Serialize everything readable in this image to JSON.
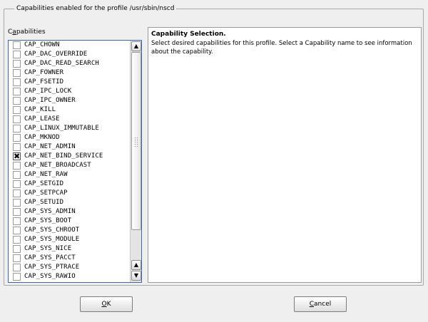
{
  "group_title": "Capabilities enabled for the profile /usr/sbin/nscd",
  "capabilities_label": {
    "pre": "C",
    "mnemonic": "a",
    "post": "pabilities"
  },
  "capabilities": [
    {
      "name": "CAP_CHOWN",
      "checked": false
    },
    {
      "name": "CAP_DAC_OVERRIDE",
      "checked": false
    },
    {
      "name": "CAP_DAC_READ_SEARCH",
      "checked": false
    },
    {
      "name": "CAP_FOWNER",
      "checked": false
    },
    {
      "name": "CAP_FSETID",
      "checked": false
    },
    {
      "name": "CAP_IPC_LOCK",
      "checked": false
    },
    {
      "name": "CAP_IPC_OWNER",
      "checked": false
    },
    {
      "name": "CAP_KILL",
      "checked": false
    },
    {
      "name": "CAP_LEASE",
      "checked": false
    },
    {
      "name": "CAP_LINUX_IMMUTABLE",
      "checked": false
    },
    {
      "name": "CAP_MKNOD",
      "checked": false
    },
    {
      "name": "CAP_NET_ADMIN",
      "checked": false
    },
    {
      "name": "CAP_NET_BIND_SERVICE",
      "checked": true
    },
    {
      "name": "CAP_NET_BROADCAST",
      "checked": false
    },
    {
      "name": "CAP_NET_RAW",
      "checked": false
    },
    {
      "name": "CAP_SETGID",
      "checked": false
    },
    {
      "name": "CAP_SETPCAP",
      "checked": false
    },
    {
      "name": "CAP_SETUID",
      "checked": false
    },
    {
      "name": "CAP_SYS_ADMIN",
      "checked": false
    },
    {
      "name": "CAP_SYS_BOOT",
      "checked": false
    },
    {
      "name": "CAP_SYS_CHROOT",
      "checked": false
    },
    {
      "name": "CAP_SYS_MODULE",
      "checked": false
    },
    {
      "name": "CAP_SYS_NICE",
      "checked": false
    },
    {
      "name": "CAP_SYS_PACCT",
      "checked": false
    },
    {
      "name": "CAP_SYS_PTRACE",
      "checked": false
    },
    {
      "name": "CAP_SYS_RAWIO",
      "checked": false
    }
  ],
  "info": {
    "title": "Capability Selection.",
    "text": "Select desired capabilities for this profile. Select a Capability name to see information about the capability."
  },
  "buttons": {
    "ok": {
      "mnemonic": "O",
      "rest": "K"
    },
    "cancel": {
      "mnemonic": "C",
      "rest": "ancel"
    }
  },
  "icons": {
    "scroll_up": "up-arrow",
    "scroll_down": "down-arrow",
    "check": "x-mark"
  }
}
